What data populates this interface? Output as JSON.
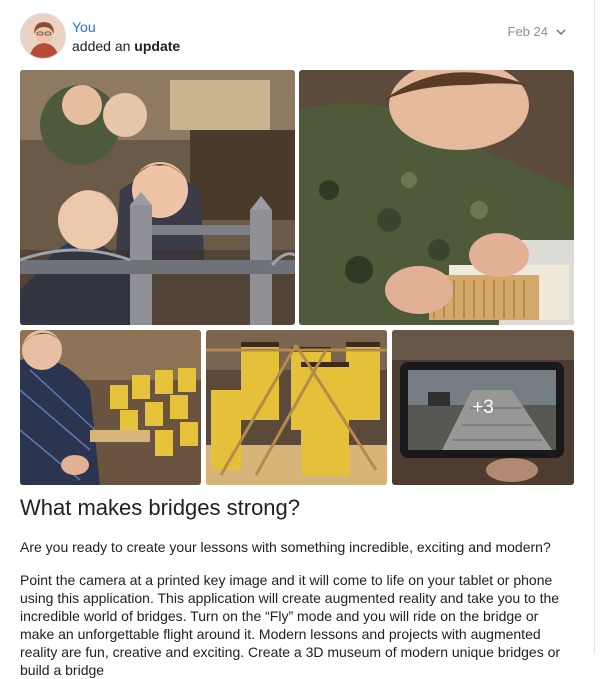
{
  "post": {
    "author": "You",
    "action_prefix": "added an",
    "action_object": "update",
    "date": "Feb 24",
    "more_photos": "+3",
    "title": "What makes bridges strong?",
    "paragraph1": "Are you ready to create your lessons with something incredible, exciting and modern?",
    "paragraph2": "Point the camera at a printed key image and it will come to life on your tablet or phone using this application. This application will create augmented reality and take you to the incredible world of bridges. Turn on the “Fly” mode and you will ride on the bridge or make an unforgettable flight around it. Modern lessons and projects with augmented reality are fun, creative and exciting. Create a 3D museum of modern unique bridges or build a bridge"
  },
  "photos": [
    {
      "id": "photo-bridge-model",
      "label": "Children with Tower Bridge model"
    },
    {
      "id": "photo-boy-building",
      "label": "Boy building with craft sticks"
    },
    {
      "id": "photo-cup-bridge",
      "label": "Child with paper cup bridge"
    },
    {
      "id": "photo-cup-structure",
      "label": "Paper cups and craft stick structure"
    },
    {
      "id": "photo-tablet-ar",
      "label": "Tablet showing AR bridge"
    }
  ],
  "colors": {
    "link": "#1a73e8",
    "muted": "#8a8f98",
    "text": "#212121"
  }
}
